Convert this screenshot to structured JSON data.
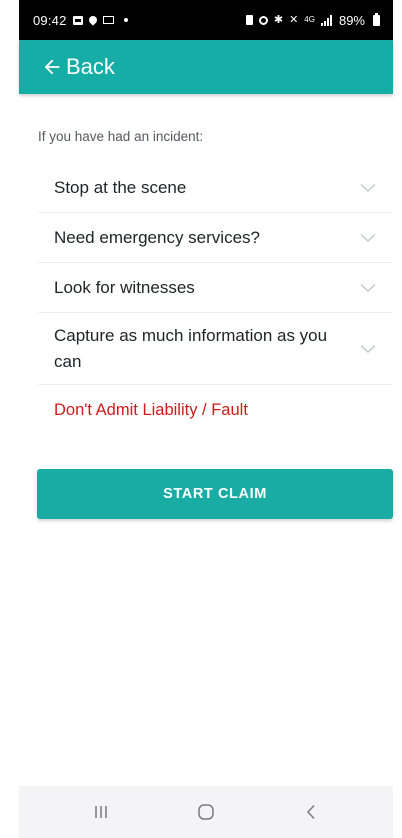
{
  "status_bar": {
    "time": "09:42",
    "network_label": "4G",
    "battery": "89%",
    "icons": [
      "image-icon",
      "location-icon",
      "mail-icon",
      "dot-icon",
      "sim-icon",
      "alarm-icon",
      "bluetooth-icon",
      "mute-icon",
      "signal-icon",
      "battery-icon"
    ]
  },
  "app_bar": {
    "back_label": "Back",
    "color": "#15ada5"
  },
  "content": {
    "intro": "If you have had an incident:",
    "items": [
      {
        "label": "Stop at the scene",
        "icon": "chevron-down-icon"
      },
      {
        "label": "Need emergency services?",
        "icon": "chevron-down-icon"
      },
      {
        "label": "Look for witnesses",
        "icon": "chevron-down-icon"
      },
      {
        "label": "Capture as much information as you can",
        "icon": "chevron-down-icon"
      }
    ],
    "warning": "Don't Admit Liability / Fault",
    "warning_color": "#d11a1a"
  },
  "cta": {
    "label": "START CLAIM",
    "color": "#18aca4"
  },
  "nav_bar": {
    "buttons": [
      "recents-icon",
      "home-icon",
      "back-icon"
    ]
  }
}
